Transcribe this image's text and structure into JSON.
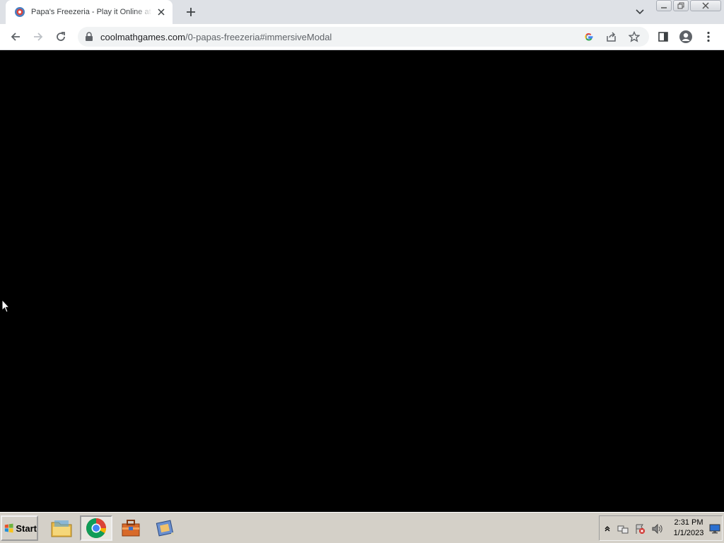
{
  "browser": {
    "tab": {
      "title": "Papa's Freezeria - Play it Online at Coolmath Games"
    },
    "address": {
      "host": "coolmathgames.com",
      "path": "/0-papas-freezeria#immersiveModal"
    }
  },
  "taskbar": {
    "start_label": "Start",
    "clock": {
      "time": "2:31 PM",
      "date": "1/1/2023"
    }
  },
  "colors": {
    "tabstrip": "#dee1e6",
    "content": "#000000",
    "taskbar": "#d4d0c8"
  }
}
